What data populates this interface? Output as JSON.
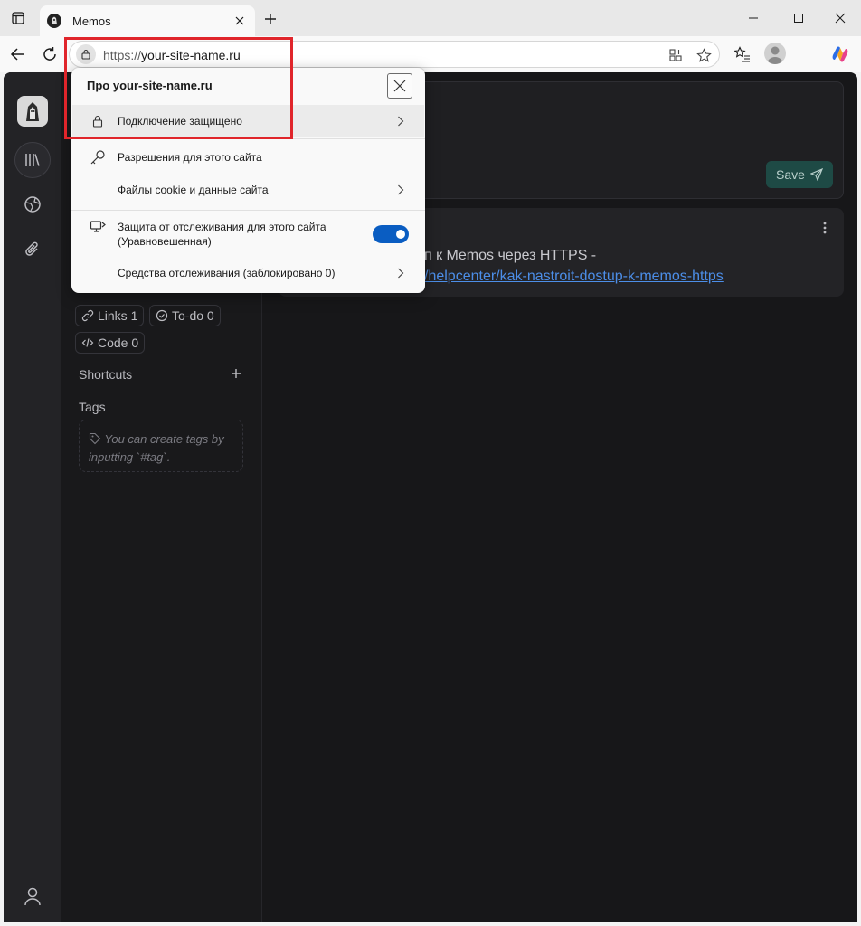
{
  "tab": {
    "title": "Memos"
  },
  "address_bar": {
    "scheme": "https://",
    "host": "your-site-name.ru"
  },
  "sidebar": {
    "chips": [
      {
        "label": "Links 1",
        "icon": "link-icon"
      },
      {
        "label": "To-do 0",
        "icon": "check-circle-icon"
      },
      {
        "label": "Code 0",
        "icon": "code-icon"
      }
    ],
    "shortcuts_heading": "Shortcuts",
    "tags_heading": "Tags",
    "tags_hint": "You can create tags by inputting `#tag`."
  },
  "editor": {
    "save_label": "Save"
  },
  "memo": {
    "text": "п к Memos через HTTPS -",
    "link": "/helpcenter/kak-nastroit-dostup-k-memos-https"
  },
  "popup": {
    "title": "Про your-site-name.ru",
    "items": [
      {
        "label": "Подключение защищено"
      },
      {
        "label": "Разрешения для этого сайта"
      },
      {
        "label": "Файлы cookie и данные сайта"
      },
      {
        "label": "Защита от отслеживания для этого сайта (Уравновешенная)"
      },
      {
        "label": "Средства отслеживания (заблокировано 0)"
      }
    ]
  },
  "colors": {
    "highlight": "#e0252b",
    "toggle_on": "#0a5dc2",
    "accent_link": "#4c8ee8",
    "save_button": "#1e4a45"
  }
}
